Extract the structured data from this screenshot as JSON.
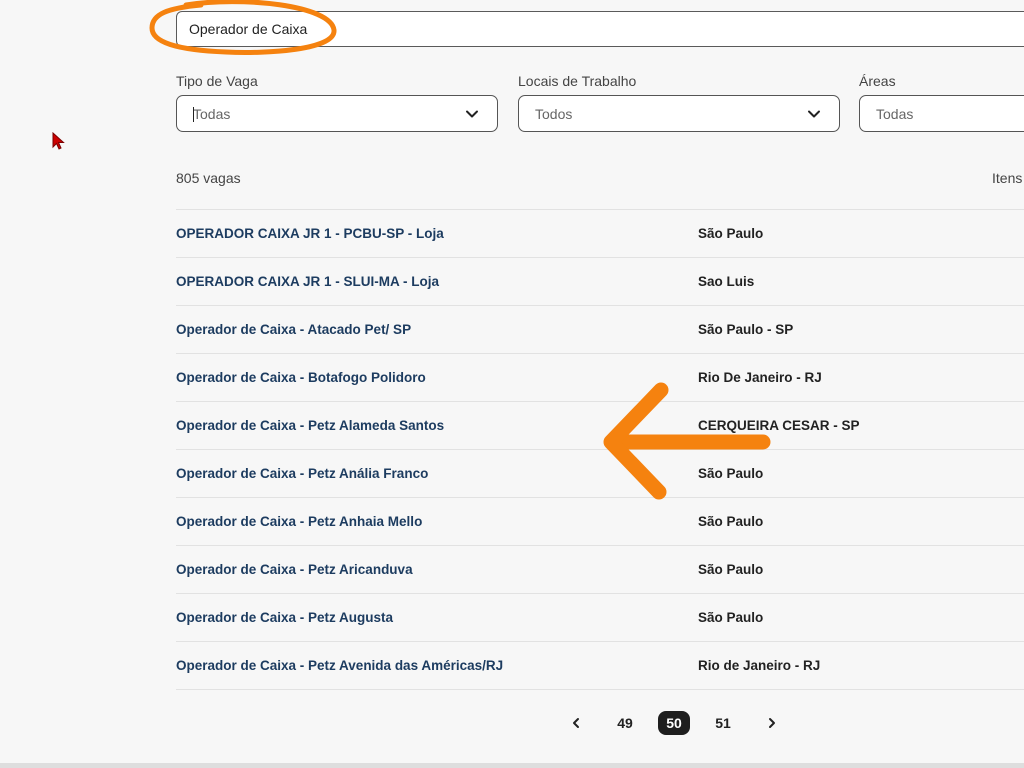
{
  "search": {
    "value": "Operador de Caixa"
  },
  "filters": [
    {
      "label": "Tipo de Vaga",
      "selected": "Todas"
    },
    {
      "label": "Locais de Trabalho",
      "selected": "Todos"
    },
    {
      "label": "Áreas",
      "selected": "Todas"
    }
  ],
  "results": {
    "count_text": "805 vagas",
    "items_label": "Itens"
  },
  "jobs": [
    {
      "title": "OPERADOR CAIXA JR 1 - PCBU-SP - Loja",
      "location": "São Paulo"
    },
    {
      "title": "OPERADOR CAIXA JR 1 - SLUI-MA - Loja",
      "location": "Sao Luis"
    },
    {
      "title": "Operador de Caixa - Atacado Pet/ SP",
      "location": "São Paulo - SP"
    },
    {
      "title": "Operador de Caixa - Botafogo Polidoro",
      "location": "Rio De Janeiro - RJ"
    },
    {
      "title": "Operador de Caixa - Petz Alameda Santos",
      "location": "CERQUEIRA CESAR - SP"
    },
    {
      "title": "Operador de Caixa - Petz Anália Franco",
      "location": "São Paulo"
    },
    {
      "title": "Operador de Caixa - Petz Anhaia Mello",
      "location": "São Paulo"
    },
    {
      "title": "Operador de Caixa - Petz Aricanduva",
      "location": "São Paulo"
    },
    {
      "title": "Operador de Caixa - Petz Augusta",
      "location": "São Paulo"
    },
    {
      "title": "Operador de Caixa - Petz Avenida das Américas/RJ",
      "location": "Rio de Janeiro - RJ"
    }
  ],
  "pagination": {
    "prev_icon": "chevron-left-icon",
    "next_icon": "chevron-right-icon",
    "pages": [
      "49",
      "50",
      "51"
    ],
    "current": "50"
  },
  "colors": {
    "annotation": "#f5820f",
    "job_title": "#1d3c60",
    "active_page_bg": "#1e1e1e",
    "cursor": "#cc0000"
  }
}
